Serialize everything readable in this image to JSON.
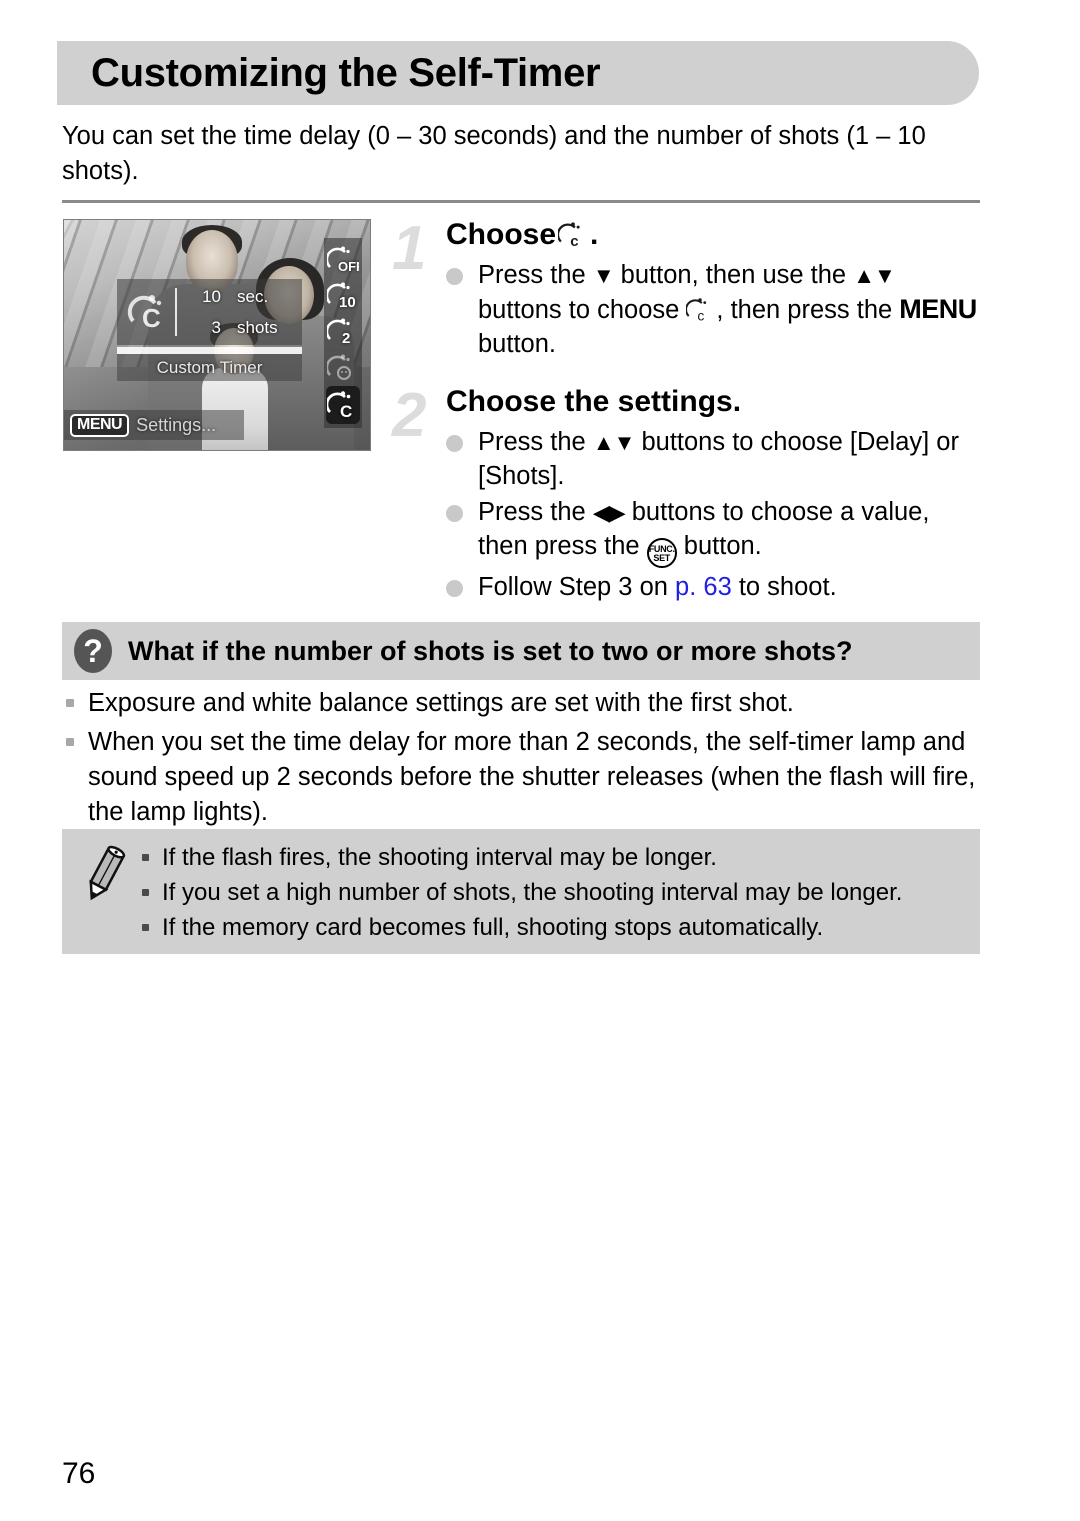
{
  "page": {
    "title": "Customizing the Self-Timer",
    "intro": "You can set the time delay (0 – 30 seconds) and the number of shots (1 – 10 shots).",
    "page_number": "76"
  },
  "camera_screen": {
    "delay_value": "10",
    "delay_unit": "sec.",
    "shots_value": "3",
    "shots_unit": "shots",
    "mode_caption": "Custom Timer",
    "menu_chip": "MENU",
    "menu_label": "Settings...",
    "timer_options": [
      {
        "name": "self-timer-off-icon",
        "label": "OFF",
        "state": "normal"
      },
      {
        "name": "self-timer-10sec-icon",
        "label": "10",
        "state": "normal"
      },
      {
        "name": "self-timer-2sec-icon",
        "label": "2",
        "state": "normal"
      },
      {
        "name": "self-timer-face-icon",
        "label": "",
        "state": "dimmed"
      },
      {
        "name": "self-timer-custom-icon",
        "label": "C",
        "state": "selected"
      }
    ]
  },
  "steps": [
    {
      "number": "1",
      "heading_before": "Choose",
      "heading_after": ".",
      "bullets": [
        {
          "parts": [
            {
              "t": "text",
              "v": "Press the "
            },
            {
              "t": "glyph",
              "v": "▼"
            },
            {
              "t": "text",
              "v": " button, then use the "
            },
            {
              "t": "glyph",
              "v": "▲▼"
            },
            {
              "t": "text",
              "v": " buttons to choose "
            },
            {
              "t": "icon",
              "v": "self-timer-custom-icon"
            },
            {
              "t": "text",
              "v": ", then press the "
            },
            {
              "t": "bold",
              "v": "MENU"
            },
            {
              "t": "text",
              "v": " button."
            }
          ]
        }
      ]
    },
    {
      "number": "2",
      "heading_before": "Choose the settings.",
      "heading_after": "",
      "bullets": [
        {
          "parts": [
            {
              "t": "text",
              "v": "Press the "
            },
            {
              "t": "glyph",
              "v": "▲▼"
            },
            {
              "t": "text",
              "v": " buttons to choose [Delay] or [Shots]."
            }
          ]
        },
        {
          "parts": [
            {
              "t": "text",
              "v": "Press the "
            },
            {
              "t": "glyph",
              "v": "◀▶"
            },
            {
              "t": "text",
              "v": " buttons to choose a value, then press the "
            },
            {
              "t": "icon",
              "v": "func-set-button-icon"
            },
            {
              "t": "text",
              "v": " button."
            }
          ]
        },
        {
          "parts": [
            {
              "t": "text",
              "v": "Follow Step 3 on "
            },
            {
              "t": "link",
              "v": "p. 63"
            },
            {
              "t": "text",
              "v": " to shoot."
            }
          ]
        }
      ]
    }
  ],
  "question_block": {
    "icon": "question-mark-icon",
    "title": "What if the number of shots is set to two or more shots?",
    "items": [
      "Exposure and white balance settings are set with the first shot.",
      "When you set the time delay for more than 2 seconds, the self-timer lamp and sound speed up 2 seconds before the shutter releases (when the flash will fire, the lamp lights)."
    ]
  },
  "note_block": {
    "icon": "pencil-icon",
    "items": [
      "If the flash fires, the shooting interval may be longer.",
      "If you set a high number of shots, the shooting interval may be longer.",
      "If the memory card becomes full, shooting stops automatically."
    ]
  },
  "colors": {
    "band_gray": "#d0d0d0",
    "link_blue": "#2020e0",
    "step_number_gray": "#dcdcdc",
    "bullet_gray": "#c9c9c9",
    "question_icon_gray": "#555555"
  }
}
